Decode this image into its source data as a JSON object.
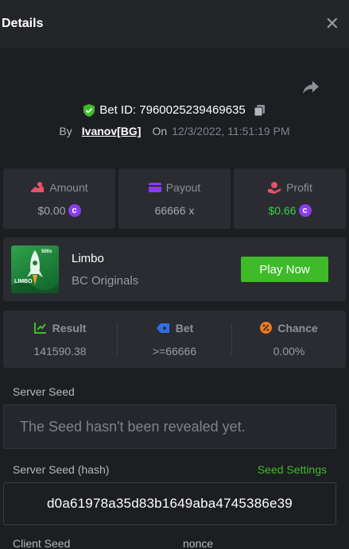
{
  "header": {
    "title": "Details",
    "close_icon": "close-icon"
  },
  "bet": {
    "id_label": "Bet ID: 7960025239469635",
    "id_value": "7960025239469635",
    "by_label": "By",
    "user": "Ivanov[BG]",
    "on_label": "On",
    "date": "12/3/2022, 11:51:19 PM"
  },
  "stats": {
    "amount": {
      "label": "Amount",
      "value": "$0.00"
    },
    "payout": {
      "label": "Payout",
      "value": "66666 x"
    },
    "profit": {
      "label": "Profit",
      "value": "$0.66"
    }
  },
  "game": {
    "name": "Limbo",
    "provider": "BC Originals",
    "play_label": "Play Now",
    "thumb_badge": "500x",
    "thumb_text": "LIMBO"
  },
  "result": {
    "result": {
      "label": "Result",
      "value": "141590.38"
    },
    "bet": {
      "label": "Bet",
      "value": ">=66666"
    },
    "chance": {
      "label": "Chance",
      "value": "0.00%"
    }
  },
  "seeds": {
    "server_seed_label": "Server Seed",
    "server_seed_placeholder": "The Seed hasn't been revealed yet.",
    "server_hash_label": "Server Seed (hash)",
    "seed_settings_label": "Seed Settings",
    "server_hash_value": "d0a61978a35d83b1649aba4745386e39",
    "client_seed_label": "Client Seed",
    "nonce_label": "nonce"
  },
  "colors": {
    "accent_green": "#3fbb29",
    "profit_green": "#33d34a",
    "coin_purple": "#8a3cf0",
    "background": "#1c1e22",
    "panel": "#2a2c31"
  }
}
